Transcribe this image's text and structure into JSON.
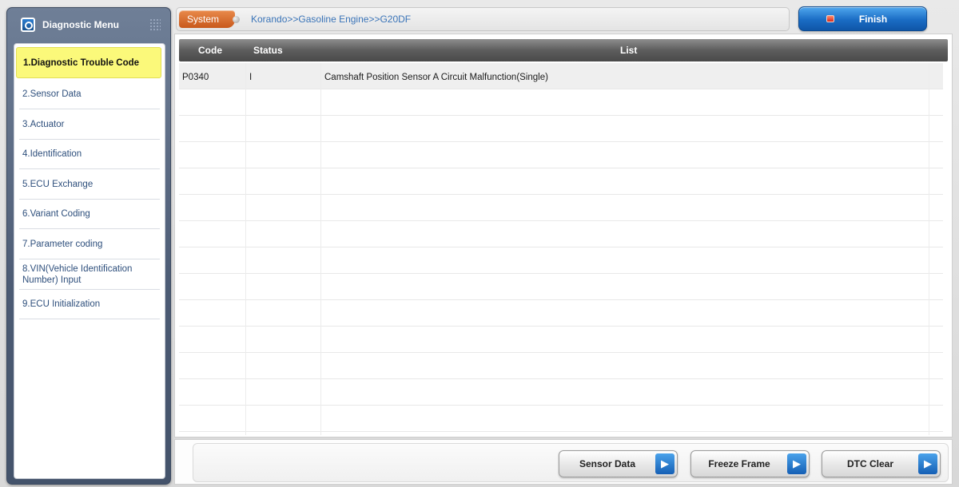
{
  "sidebar": {
    "title": "Diagnostic Menu",
    "items": [
      {
        "label": "1.Diagnostic Trouble Code"
      },
      {
        "label": "2.Sensor Data"
      },
      {
        "label": "3.Actuator"
      },
      {
        "label": "4.Identification"
      },
      {
        "label": "5.ECU Exchange"
      },
      {
        "label": "6.Variant Coding"
      },
      {
        "label": "7.Parameter coding"
      },
      {
        "label": "8.VIN(Vehicle Identification Number) Input"
      },
      {
        "label": "9.ECU Initialization"
      }
    ],
    "active_index": 0
  },
  "topbar": {
    "system_label": "System",
    "breadcrumb": "Korando>>Gasoline Engine>>G20DF",
    "finish_label": "Finish"
  },
  "table": {
    "columns": [
      "Code",
      "Status",
      "List"
    ],
    "rows": [
      {
        "code": "P0340",
        "status": "I",
        "list": "Camshaft Position Sensor A Circuit Malfunction(Single)"
      }
    ]
  },
  "actions": {
    "sensor_data_label": "Sensor Data",
    "freeze_frame_label": "Freeze Frame",
    "dtc_clear_label": "DTC Clear"
  },
  "colors": {
    "active_item": "#fbf97a",
    "system_tab": "#d86a2a",
    "finish_button": "#1a6cc4",
    "link_text": "#3a74b8"
  }
}
